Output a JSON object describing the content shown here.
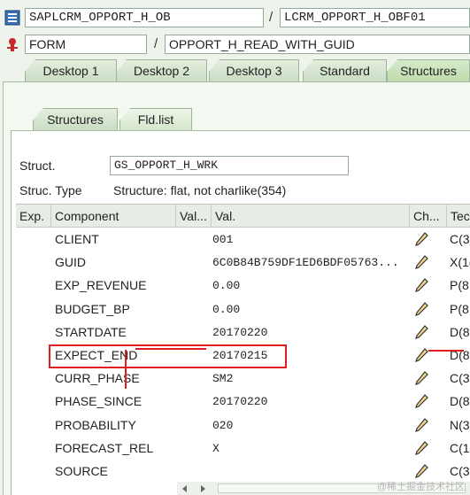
{
  "program": {
    "name": "SAPLCRM_OPPORT_H_OB",
    "include": "LCRM_OPPORT_H_OBF01"
  },
  "event": {
    "type": "FORM",
    "name": "OPPORT_H_READ_WITH_GUID"
  },
  "desktop_tabs": [
    "Desktop 1",
    "Desktop 2",
    "Desktop 3",
    "Standard",
    "Structures"
  ],
  "sub_tabs": [
    "Structures",
    "Fld.list"
  ],
  "struct": {
    "label": "Struct.",
    "value": "GS_OPPORT_H_WRK"
  },
  "struct_type": {
    "label": "Struc. Type",
    "value": "Structure: flat, not charlike(354)"
  },
  "columns": {
    "exp": "Exp.",
    "component": "Component",
    "val_short": "Val...",
    "val": "Val.",
    "ch": "Ch...",
    "tech": "Tec"
  },
  "rows": [
    {
      "component": "CLIENT",
      "value": "001",
      "tech": "C(3"
    },
    {
      "component": "GUID",
      "value": "6C0B84B759DF1ED6BDF05763...",
      "tech": "X(1("
    },
    {
      "component": "EXP_REVENUE",
      "value": "0.00",
      "tech": "P(8"
    },
    {
      "component": "BUDGET_BP",
      "value": "0.00",
      "tech": "P(8"
    },
    {
      "component": "STARTDATE",
      "value": "20170220",
      "tech": "D(8"
    },
    {
      "component": "EXPECT_END",
      "value": "20170215",
      "tech": "D(8"
    },
    {
      "component": "CURR_PHASE",
      "value": "SM2",
      "tech": "C(3"
    },
    {
      "component": "PHASE_SINCE",
      "value": "20170220",
      "tech": "D(8"
    },
    {
      "component": "PROBABILITY",
      "value": "020",
      "tech": "N(3"
    },
    {
      "component": "FORECAST_REL",
      "value": "X",
      "tech": "C(1"
    },
    {
      "component": "SOURCE",
      "value": "",
      "tech": "C(3"
    }
  ],
  "watermark": "@稀土掘金技术社区",
  "colors": {
    "highlight": "#e02020",
    "tab_active": "#bedaa9"
  }
}
